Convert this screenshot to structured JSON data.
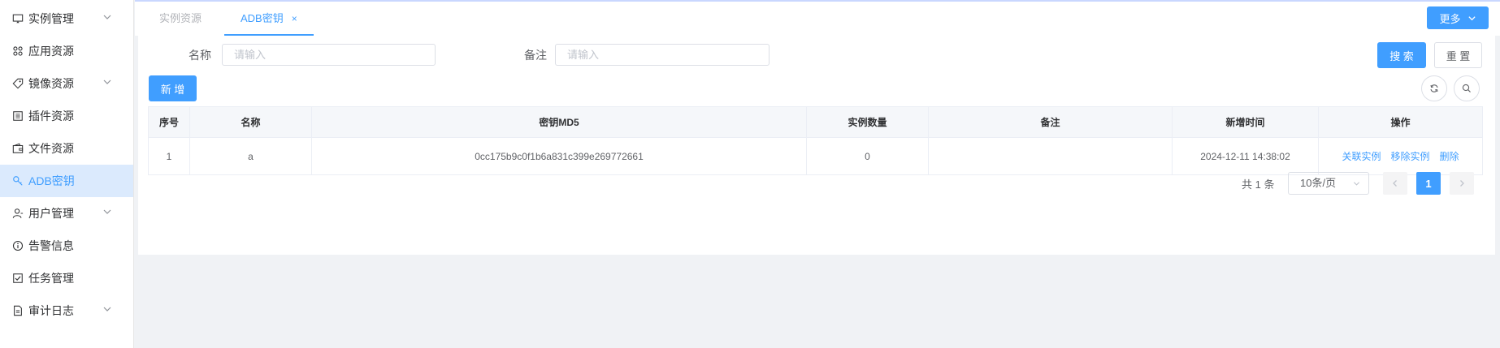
{
  "sidebar": {
    "items": [
      {
        "label": "实例管理",
        "icon": "monitor-icon",
        "has_children": true
      },
      {
        "label": "应用资源",
        "icon": "grid-icon",
        "has_children": false
      },
      {
        "label": "镜像资源",
        "icon": "tag-icon",
        "has_children": true
      },
      {
        "label": "插件资源",
        "icon": "list-icon",
        "has_children": false
      },
      {
        "label": "文件资源",
        "icon": "wallet-icon",
        "has_children": false
      },
      {
        "label": "ADB密钥",
        "icon": "key-icon",
        "has_children": false,
        "active": true
      },
      {
        "label": "用户管理",
        "icon": "user-icon",
        "has_children": true
      },
      {
        "label": "告警信息",
        "icon": "info-icon",
        "has_children": false
      },
      {
        "label": "任务管理",
        "icon": "checkbox-icon",
        "has_children": false
      },
      {
        "label": "审计日志",
        "icon": "document-icon",
        "has_children": true
      }
    ]
  },
  "tabs": [
    {
      "label": "实例资源",
      "active": false
    },
    {
      "label": "ADB密钥",
      "active": true,
      "close": "×"
    }
  ],
  "more_button": "更多",
  "search": {
    "name_label": "名称",
    "name_placeholder": "请输入",
    "remark_label": "备注",
    "remark_placeholder": "请输入",
    "search_button": "搜 索",
    "reset_button": "重 置"
  },
  "add_button": "新 增",
  "table": {
    "columns": [
      "序号",
      "名称",
      "密钥MD5",
      "实例数量",
      "备注",
      "新增时间",
      "操作"
    ],
    "rows": [
      {
        "index": "1",
        "name": "a",
        "md5": "0cc175b9c0f1b6a831c399e269772661",
        "instance_count": "0",
        "remark": "",
        "created": "2024-12-11 14:38:02",
        "actions": [
          "关联实例",
          "移除实例",
          "删除"
        ]
      }
    ]
  },
  "pagination": {
    "total": "共 1 条",
    "page_size": "10条/页",
    "current_page": "1"
  },
  "colors": {
    "primary": "#409eff",
    "active_bg": "#dbeafd"
  }
}
